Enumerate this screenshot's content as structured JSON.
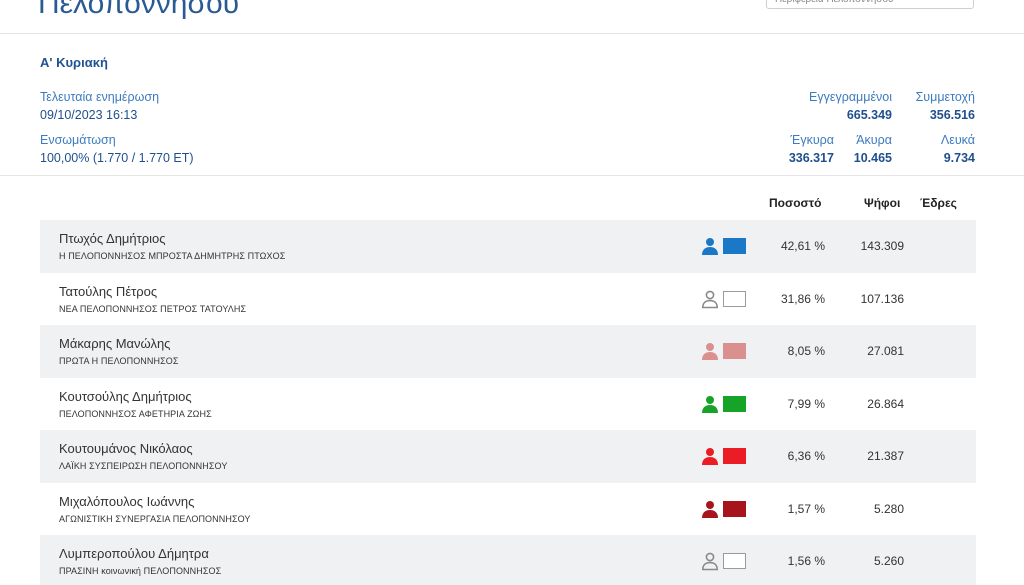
{
  "header": {
    "region_title": "Πελοποννήσου",
    "region_select_text": "Περιφέρεια Πελοποννήσου"
  },
  "summary": {
    "round": "Α' Κυριακή",
    "last_update_label": "Τελευταία ενημέρωση",
    "last_update_value": "09/10/2023 16:13",
    "integration_label": "Ενσωμάτωση",
    "integration_value": "100,00% (1.770 / 1.770 ΕΤ)",
    "registered_label": "Εγγεγραμμένοι",
    "registered_value": "665.349",
    "turnout_label": "Συμμετοχή",
    "turnout_value": "356.516",
    "valid_label": "Έγκυρα",
    "valid_value": "336.317",
    "invalid_label": "Άκυρα",
    "invalid_value": "10.465",
    "blank_label": "Λευκά",
    "blank_value": "9.734"
  },
  "results": {
    "headers": {
      "percent": "Ποσοστό",
      "votes": "Ψήφοι",
      "seats": "Έδρες"
    },
    "rows": [
      {
        "candidate": "Πτωχός Δημήτριος",
        "party": "Η ΠΕΛΟΠΟΝΝΗΣΟΣ ΜΠΡΟΣΤΑ ΔΗΜΗΤΡΗΣ ΠΤΩΧΟΣ",
        "percent": "42,61 %",
        "votes": "143.309",
        "color": "#1a78c6",
        "icon": "person-icon"
      },
      {
        "candidate": "Τατούλης Πέτρος",
        "party": "ΝΕΑ ΠΕΛΟΠΟΝΝΗΣΟΣ ΠΕΤΡΟΣ ΤΑΤΟΥΛΗΣ",
        "percent": "31,86 %",
        "votes": "107.136",
        "color": "#ffffff",
        "icon": "person-outline-icon"
      },
      {
        "candidate": "Μάκαρης Μανώλης",
        "party": "ΠΡΩΤΑ Η ΠΕΛΟΠΟΝΝΗΣΟΣ",
        "percent": "8,05 %",
        "votes": "27.081",
        "color": "#d9908f",
        "icon": "person-icon"
      },
      {
        "candidate": "Κουτσούλης Δημήτριος",
        "party": "ΠΕΛΟΠΟΝΝΗΣΟΣ ΑΦΕΤΗΡΙΑ ΖΩΗΣ",
        "percent": "7,99 %",
        "votes": "26.864",
        "color": "#17a327",
        "icon": "person-icon"
      },
      {
        "candidate": "Κουτουμάνος Νικόλαος",
        "party": "ΛΑΪΚΗ ΣΥΣΠΕΙΡΩΣΗ ΠΕΛΟΠΟΝΝΗΣΟΥ",
        "percent": "6,36 %",
        "votes": "21.387",
        "color": "#ec1c24",
        "icon": "person-icon"
      },
      {
        "candidate": "Μιχαλόπουλος Ιωάννης",
        "party": "ΑΓΩΝΙΣΤΙΚΗ ΣΥΝΕΡΓΑΣΙΑ ΠΕΛΟΠΟΝΝΗΣΟΥ",
        "percent": "1,57 %",
        "votes": "5.280",
        "color": "#a8141b",
        "icon": "person-icon"
      },
      {
        "candidate": "Λυμπεροπούλου Δήμητρα",
        "party": "ΠΡΑΣΙΝΗ κοινωνική ΠΕΛΟΠΟΝΝΗΣΟΣ",
        "percent": "1,56 %",
        "votes": "5.260",
        "color": "#ffffff",
        "icon": "person-outline-icon"
      }
    ]
  }
}
